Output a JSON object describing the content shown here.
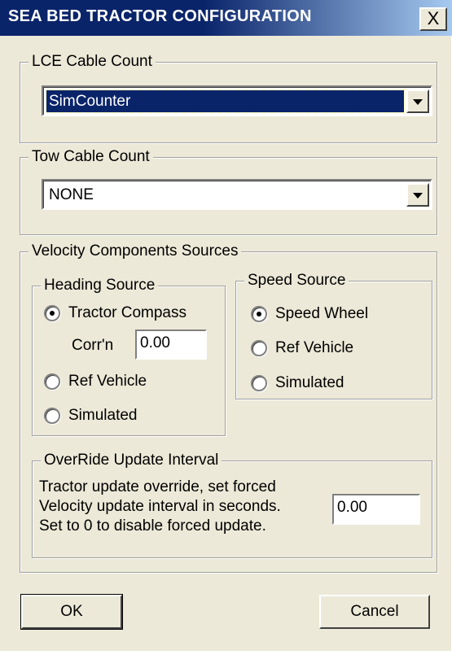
{
  "window": {
    "title": "SEA BED TRACTOR CONFIGURATION",
    "close_label": "X"
  },
  "lce_group": {
    "legend": "LCE Cable Count",
    "selected": "SimCounter"
  },
  "tow_group": {
    "legend": "Tow Cable Count",
    "selected": "NONE"
  },
  "velocity_group": {
    "legend": "Velocity Components Sources",
    "heading": {
      "legend": "Heading Source",
      "options": [
        "Tractor Compass",
        "Ref Vehicle",
        "Simulated"
      ],
      "selected_index": 0,
      "corr_label": "Corr'n",
      "corr_value": "0.00"
    },
    "speed": {
      "legend": "Speed Source",
      "options": [
        "Speed Wheel",
        "Ref Vehicle",
        "Simulated"
      ],
      "selected_index": 0
    },
    "override": {
      "legend": "OverRide Update Interval",
      "lines": [
        "Tractor update override, set forced",
        "Velocity update interval in seconds.",
        "Set to 0 to disable forced update."
      ],
      "value": "0.00"
    }
  },
  "buttons": {
    "ok": "OK",
    "cancel": "Cancel"
  },
  "colors": {
    "title_bar": "#0a246a",
    "selection": "#0a246a",
    "face": "#ece9d8"
  },
  "icons": {
    "radio": "radio-button",
    "dropdown": "chevron-down-icon",
    "close": "close-icon"
  }
}
